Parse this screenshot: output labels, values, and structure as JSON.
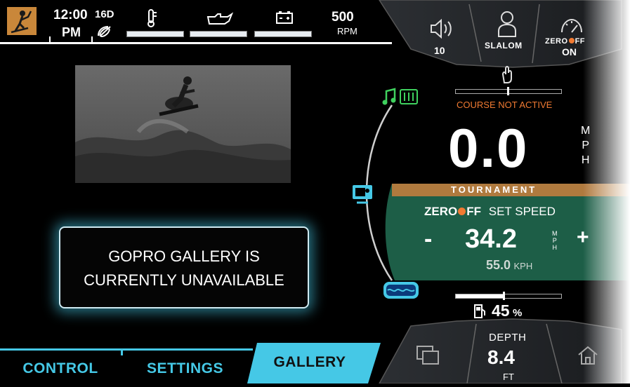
{
  "status_bar": {
    "time": "12:00",
    "ampm": "PM",
    "gps": "16D",
    "temp_level": 1.0,
    "oil_level": 1.0,
    "battery_level": 1.0,
    "rpm_value": "500",
    "rpm_label": "RPM"
  },
  "top_controls": {
    "volume_value": "10",
    "profile_label": "SLALOM",
    "zerooff_brand_left": "ZERO",
    "zerooff_brand_right": "FF",
    "zerooff_state": "ON"
  },
  "left_panel": {
    "unavailable_line1": "GOPRO GALLERY IS",
    "unavailable_line2": "CURRENTLY UNAVAILABLE"
  },
  "tabs": [
    {
      "label": "CONTROL"
    },
    {
      "label": "SETTINGS"
    },
    {
      "label": "GALLERY"
    }
  ],
  "course": {
    "status": "COURSE NOT ACTIVE"
  },
  "speed": {
    "value": "0.0",
    "unit_m": "M",
    "unit_p": "P",
    "unit_h": "H"
  },
  "tournament": {
    "label": "TOURNAMENT"
  },
  "set_speed": {
    "brand_left": "ZERO",
    "brand_right": "FF",
    "label": "SET SPEED",
    "minus": "-",
    "plus": "+",
    "value": "34.2",
    "unit_m": "M",
    "unit_p": "P",
    "unit_h": "H",
    "kph_value": "55.0",
    "kph_label": "KPH"
  },
  "fuel": {
    "level_percent": 45,
    "value": "45",
    "unit": "%"
  },
  "depth": {
    "label": "DEPTH",
    "value": "8.4",
    "unit": "FT"
  },
  "colors": {
    "accent_cyan": "#45c8e6",
    "orange": "#f07a32",
    "green_panel": "#1d5e47",
    "tournament_bar": "#b07a3e",
    "music_green": "#3fd15e"
  },
  "icons": {
    "skier": "skier-icon",
    "volume": "speaker-icon",
    "profile": "person-icon",
    "zerooff": "speedometer-icon",
    "course": "hand-icon",
    "music": "music-icon",
    "display": "screen-icon",
    "ballast": "water-tank-icon",
    "fuel": "fuel-pump-icon",
    "gallery": "multi-window-icon",
    "home": "home-icon"
  }
}
